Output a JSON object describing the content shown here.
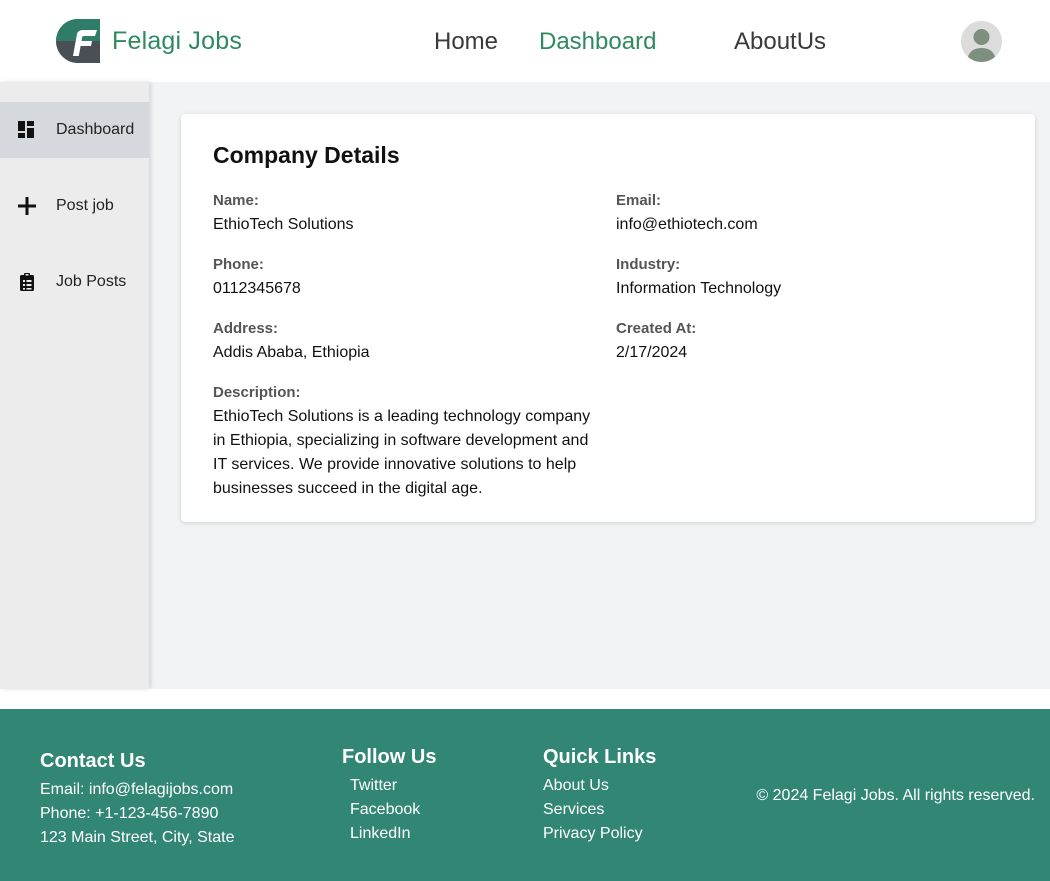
{
  "header": {
    "brand_name": "Felagi Jobs",
    "nav": {
      "home": "Home",
      "dashboard": "Dashboard",
      "about": "AboutUs"
    }
  },
  "sidebar": {
    "items": [
      {
        "label": "Dashboard",
        "icon": "dashboard-icon",
        "active": true
      },
      {
        "label": "Post job",
        "icon": "plus-icon",
        "active": false
      },
      {
        "label": "Job Posts",
        "icon": "clipboard-icon",
        "active": false
      }
    ]
  },
  "company": {
    "title": "Company Details",
    "fields": {
      "name": {
        "label": "Name:",
        "value": "EthioTech Solutions"
      },
      "email": {
        "label": "Email:",
        "value": "info@ethiotech.com"
      },
      "phone": {
        "label": "Phone:",
        "value": "0112345678"
      },
      "industry": {
        "label": "Industry:",
        "value": "Information Technology"
      },
      "address": {
        "label": "Address:",
        "value": "Addis Ababa, Ethiopia"
      },
      "created_at": {
        "label": "Created At:",
        "value": "2/17/2024"
      },
      "description": {
        "label": "Description:",
        "value": "EthioTech Solutions is a leading technology company in Ethiopia, specializing in software development and IT services. We provide innovative solutions to help businesses succeed in the digital age."
      }
    }
  },
  "footer": {
    "contact": {
      "heading": "Contact Us",
      "email": "Email: info@felagijobs.com",
      "phone": "Phone: +1-123-456-7890",
      "address": "123 Main Street, City, State"
    },
    "follow": {
      "heading": "Follow Us",
      "links": [
        "Twitter",
        "Facebook",
        "LinkedIn"
      ]
    },
    "quick": {
      "heading": "Quick Links",
      "links": [
        "About Us",
        "Services",
        "Privacy Policy"
      ]
    },
    "copyright": "© 2024 Felagi Jobs. All rights reserved."
  },
  "colors": {
    "brand_green": "#2f8a5f",
    "footer_bg": "#328674",
    "sidebar_bg": "#ececec",
    "sidebar_active": "#d5d8dc",
    "page_bg": "#f2f3f4"
  }
}
